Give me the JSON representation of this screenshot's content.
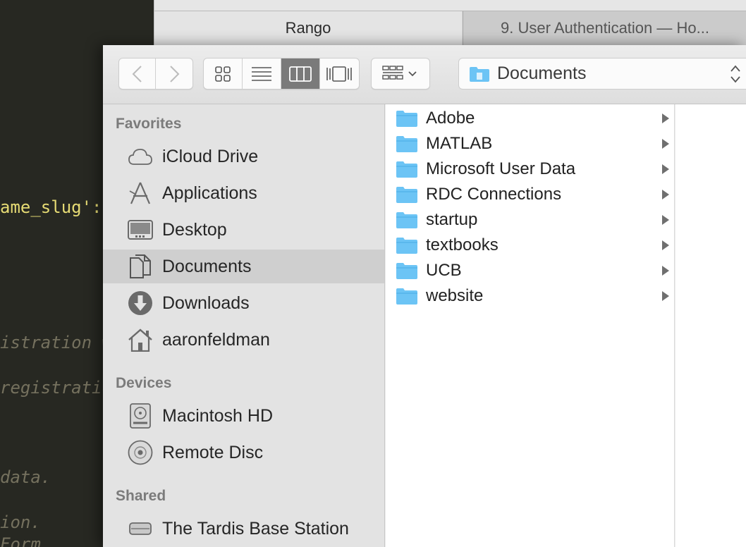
{
  "editor": {
    "lines": [
      {
        "text": "ame_slug':",
        "kind": "str"
      },
      {
        "text": "istration w",
        "kind": "comment"
      },
      {
        "text": "registratio",
        "kind": "comment"
      },
      {
        "text": " data.",
        "kind": "comment"
      },
      {
        "text": "ion.",
        "kind": "comment"
      },
      {
        "text": "Form",
        "kind": "comment"
      }
    ]
  },
  "browser": {
    "tabs": [
      {
        "label": "Rango"
      },
      {
        "label": "9. User Authentication — Ho..."
      }
    ]
  },
  "toolbar": {
    "nav": {
      "back_icon": "chevron-left-icon",
      "forward_icon": "chevron-right-icon"
    },
    "views": [
      {
        "icon": "icon-view-icon",
        "active": false
      },
      {
        "icon": "list-view-icon",
        "active": false
      },
      {
        "icon": "column-view-icon",
        "active": true
      },
      {
        "icon": "cover-flow-icon",
        "active": false
      }
    ],
    "arrange_icon": "arrange-grid-icon",
    "path": {
      "label": "Documents",
      "icon": "documents-folder-icon"
    }
  },
  "sidebar": {
    "sections": [
      {
        "title": "Favorites",
        "items": [
          {
            "label": "iCloud Drive",
            "icon": "cloud-icon",
            "selected": false
          },
          {
            "label": "Applications",
            "icon": "applications-icon",
            "selected": false
          },
          {
            "label": "Desktop",
            "icon": "desktop-icon",
            "selected": false
          },
          {
            "label": "Documents",
            "icon": "documents-icon",
            "selected": true
          },
          {
            "label": "Downloads",
            "icon": "download-icon",
            "selected": false
          },
          {
            "label": "aaronfeldman",
            "icon": "home-icon",
            "selected": false
          }
        ]
      },
      {
        "title": "Devices",
        "items": [
          {
            "label": "Macintosh HD",
            "icon": "hard-drive-icon",
            "selected": false
          },
          {
            "label": "Remote Disc",
            "icon": "disc-icon",
            "selected": false
          }
        ]
      },
      {
        "title": "Shared",
        "items": [
          {
            "label": "The Tardis Base Station",
            "icon": "base-station-icon",
            "selected": false
          }
        ]
      }
    ]
  },
  "column1": {
    "items": [
      {
        "name": "Adobe"
      },
      {
        "name": "MATLAB"
      },
      {
        "name": "Microsoft User Data"
      },
      {
        "name": "RDC Connections"
      },
      {
        "name": "startup"
      },
      {
        "name": "textbooks"
      },
      {
        "name": "UCB"
      },
      {
        "name": "website"
      }
    ]
  },
  "colors": {
    "folder_blue": "#6cc4f5",
    "selected_sidebar": "#cfcfcf",
    "editor_bg": "#272822"
  }
}
